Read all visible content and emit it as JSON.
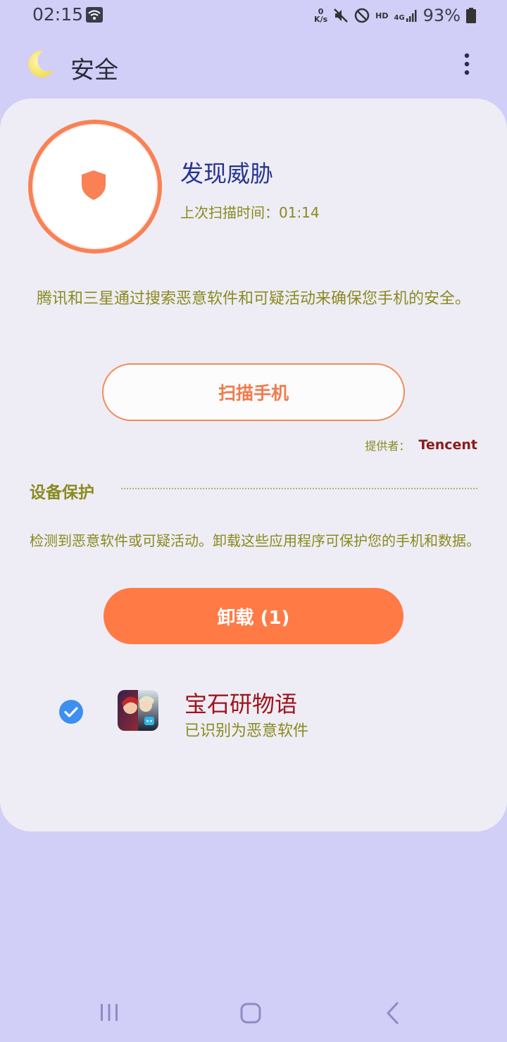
{
  "status_bar": {
    "time": "02:15",
    "speed_value": "0",
    "speed_unit": "K/s",
    "hd": "HD",
    "network": "4G",
    "battery": "93%"
  },
  "app_bar": {
    "title": "安全",
    "icons": [
      "moon-icon",
      "more-vertical-icon"
    ]
  },
  "status_card": {
    "title": "发现威胁",
    "last_scan": "上次扫描时间：01:14",
    "icon": "shield-icon",
    "accent_color": "#f98155"
  },
  "description": "腾讯和三星通过搜索恶意软件和可疑活动来确保您手机的安全。",
  "scan_button_label": "扫描手机",
  "provider": {
    "label": "提供者：",
    "name": "Tencent"
  },
  "device_protection": {
    "title": "设备保护",
    "description": "检测到恶意软件或可疑活动。卸载这些应用程序可保护您的手机和数据。",
    "uninstall_label": "卸载 (1)",
    "apps": [
      {
        "name": "宝石研物语",
        "status": "已识别为恶意软件",
        "checked": true
      }
    ]
  },
  "nav_bar": {
    "icons": [
      "recents-icon",
      "home-icon",
      "back-icon"
    ]
  },
  "colors": {
    "background": "#d1cef7",
    "card": "#eeedf5",
    "accent_orange": "#ff7a45",
    "title_blue": "#283593",
    "olive_text": "#8a8a1f",
    "malware_red": "#a0141b"
  }
}
